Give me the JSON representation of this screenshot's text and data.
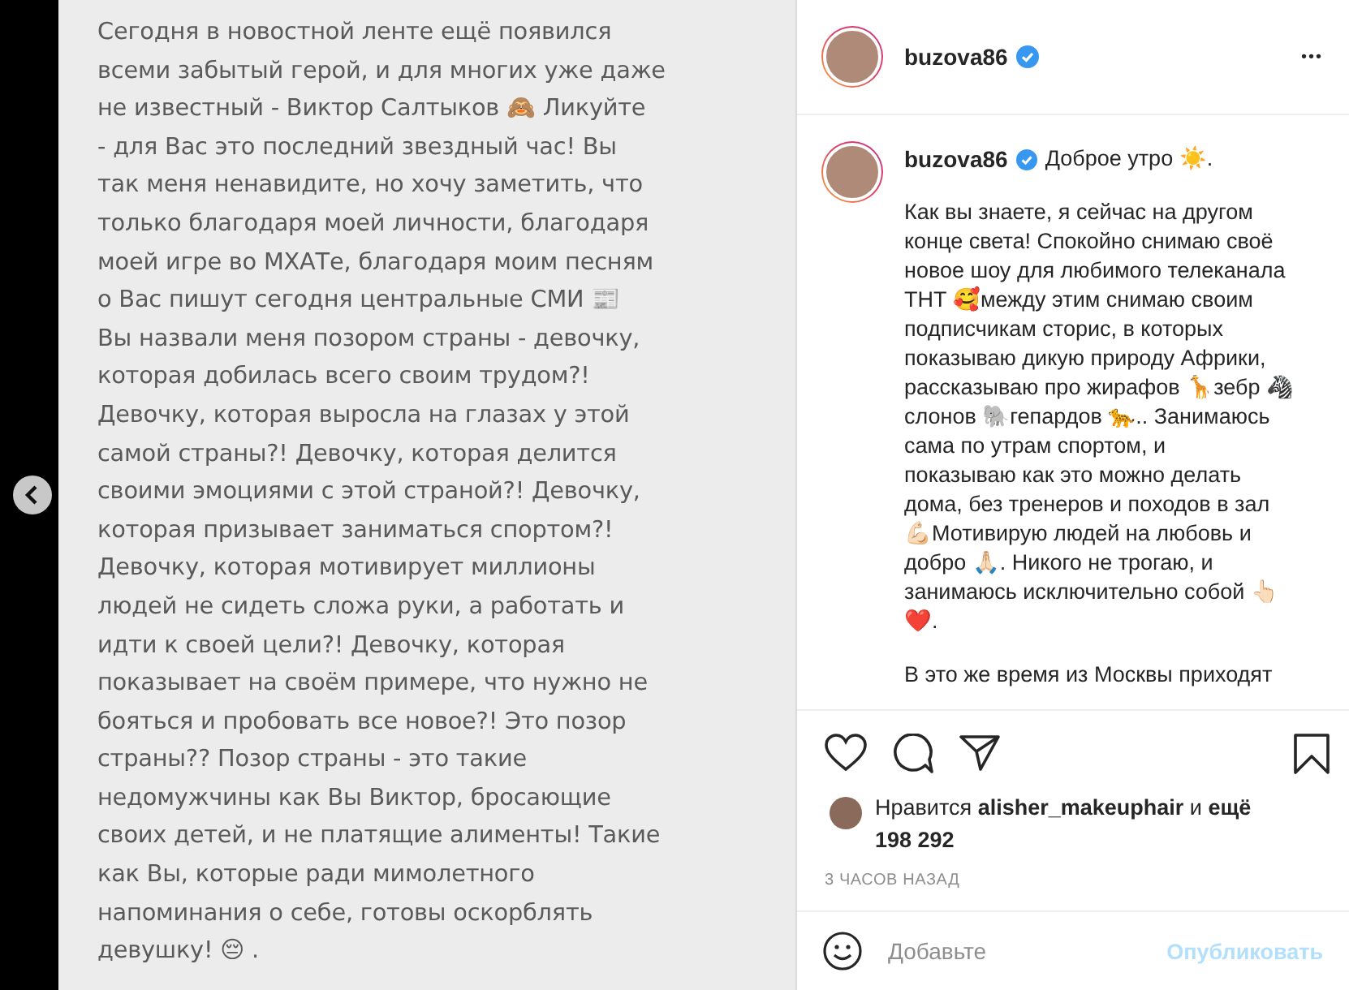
{
  "image_post": {
    "lines": [
      "Сегодня в новостной ленте ещё появился",
      "всеми забытый герой, и для многих уже даже",
      "не известный - Виктор Салтыков 🙈 Ликуйте",
      "- для Вас это последний звездный час! Вы",
      "так меня ненавидите, но хочу заметить, что",
      "только благодаря моей личности, благодаря",
      "моей игре во МХАТе, благодаря моим песням",
      "о Вас пишут сегодня центральные СМИ 📰",
      "Вы назвали меня позором страны - девочку,",
      "которая добилась всего своим трудом?!",
      "Девочку, которая выросла на глазах у этой",
      "самой страны?! Девочку, которая делится",
      "своими эмоциями с этой страной?! Девочку,",
      "которая призывает заниматься спортом?!",
      "Девочку, которая мотивирует миллионы",
      "людей не сидеть сложа руки, а работать и",
      "идти к своей цели?! Девочку, которая",
      "показывает на своём примере, что нужно не",
      "бояться и пробовать все новое?! Это позор",
      "страны?? Позор страны - это такие",
      "недомужчины как Вы Виктор, бросающие",
      "своих детей, и не платящие алименты! Такие",
      "как Вы, которые ради мимолетного",
      "напоминания о себе, готовы оскорблять",
      "девушку! 😔 ."
    ]
  },
  "post": {
    "username": "buzova86",
    "verified": true,
    "more": "•••",
    "caption": {
      "username": "buzova86",
      "verified": true,
      "greeting": "Доброе утро ☀️.",
      "paragraphs": [
        [
          "Как вы знаете, я сейчас на другом",
          "конце света! Спокойно снимаю своё",
          "новое шоу для любимого телеканала",
          "ТНТ 🥰между этим снимаю своим",
          "подписчикам сторис, в которых",
          "показываю дикую природу Африки,",
          "рассказываю про жирафов 🦒зебр 🦓",
          "слонов 🐘гепардов 🐆.. Занимаюсь",
          "сама по утрам спортом, и",
          "показываю как это можно делать",
          "дома, без тренеров и походов в зал",
          "💪🏻Мотивирую людей на любовь и",
          "добро 🙏🏻. Никого не трогаю, и",
          "занимаюсь исключительно собой 👆🏻",
          "❤️."
        ],
        [
          "В это же время из Москвы приходят"
        ]
      ]
    },
    "likes": "Нравится **alisher_makeuphair** и **ещё 198 292**",
    "time": "3 ЧАСОВ НАЗАД",
    "comment": {
      "placeholder": "Добавьте",
      "submit": "Опубликовать",
      "submit_disabled": true
    }
  }
}
